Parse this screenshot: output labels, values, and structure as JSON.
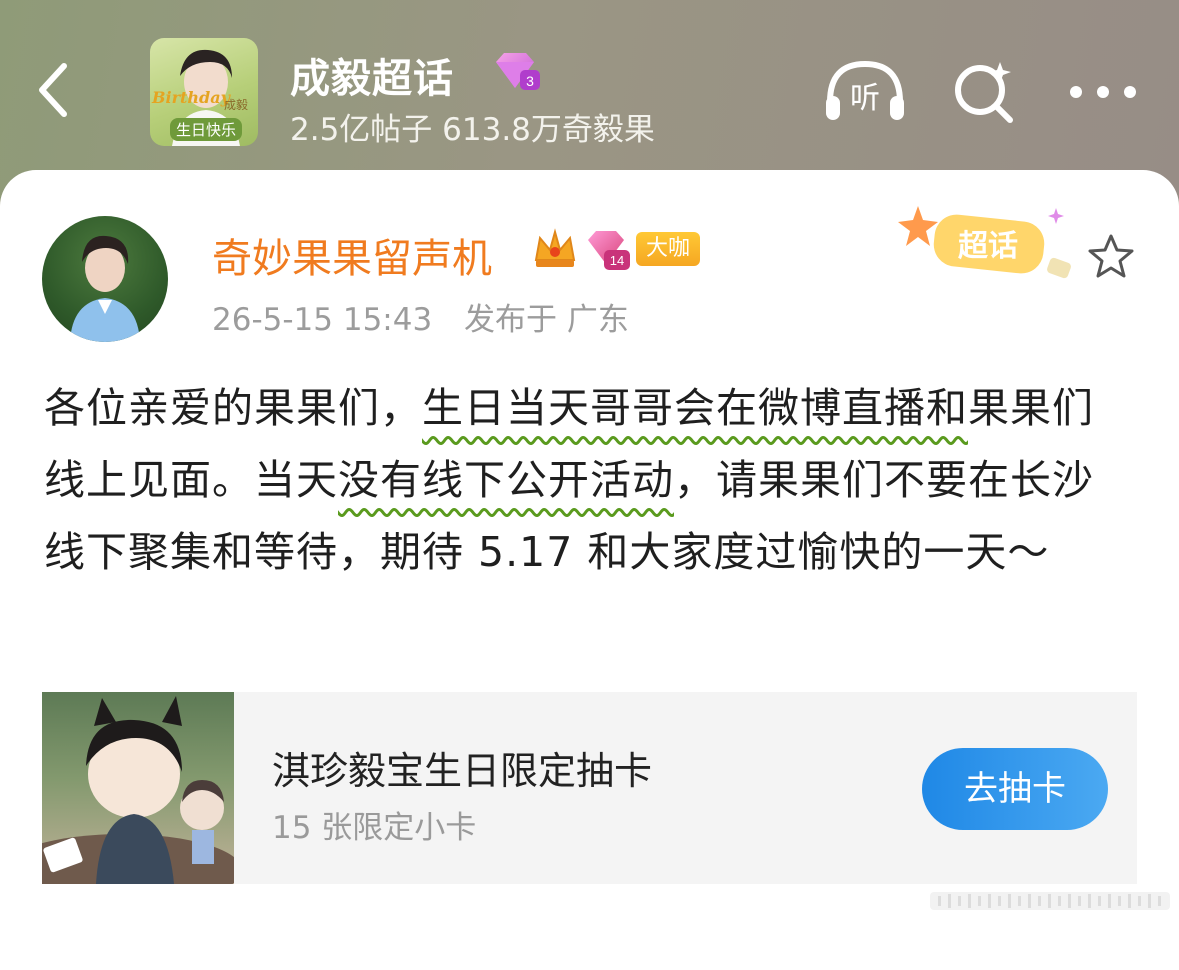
{
  "header": {
    "title": "成毅超话",
    "badge_level": "3",
    "stats": "2.5亿帖子 613.8万奇毅果",
    "avatar_text": "生日快乐",
    "avatar_name": "成毅",
    "avatar_script": "Birthday",
    "listen_label": "听"
  },
  "post": {
    "author": {
      "name": "奇妙果果留声机",
      "level": "14",
      "badge": "大咖"
    },
    "timestamp": "26-5-15 15:43",
    "location": "发布于 广东",
    "sticker_label": "超话",
    "text": {
      "p1": "各位亲爱的果果们，",
      "p2": "生日当天哥哥会在微博直播和",
      "p3": "果果们线上见面。当天",
      "p4": "没有线下公开活动",
      "p5": "，请果果们不要在长沙线下聚集和等待，期待 5.17 和大家度过愉快的一天～"
    }
  },
  "promo": {
    "title": "淇珍毅宝生日限定抽卡",
    "subtitle": "15 张限定小卡",
    "button": "去抽卡"
  },
  "colors": {
    "accent_orange": "#f07b1f",
    "button_blue": "#2b8ee9",
    "wavy_green": "#5a9a1e"
  }
}
